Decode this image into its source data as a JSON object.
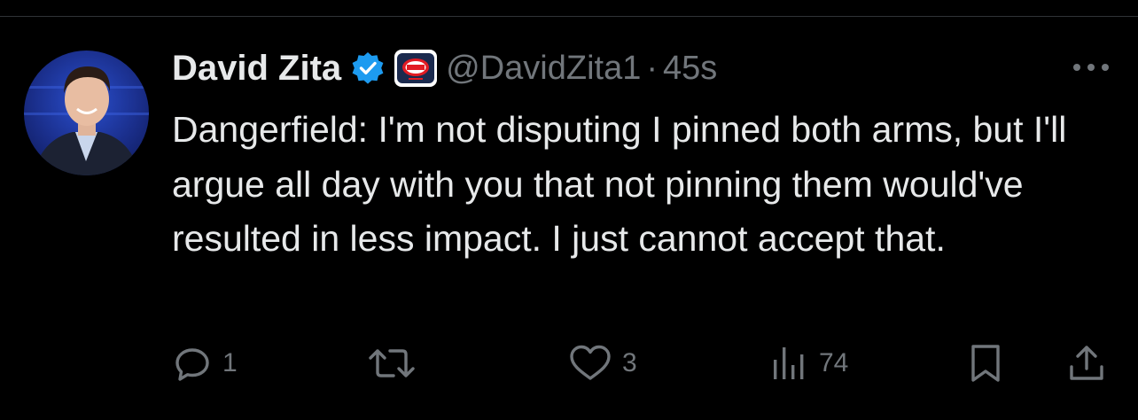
{
  "tweet": {
    "author": {
      "display_name": "David Zita",
      "handle": "@DavidZita1",
      "verified": true,
      "affiliation_badge": "fox-footy-logo"
    },
    "separator": "·",
    "timestamp": "45s",
    "text": "Dangerfield: I'm not disputing I pinned both arms, but I'll argue all day with you that not pinning them would've resulted in less impact. I just cannot accept that.",
    "actions": {
      "replies": "1",
      "reposts": "",
      "likes": "3",
      "views": "74"
    }
  },
  "colors": {
    "background": "#000000",
    "text_primary": "#e7e9ea",
    "text_secondary": "#71767b",
    "verified_blue": "#1d9bf0",
    "divider": "#2f3336"
  },
  "icons": {
    "more": "more-horizontal-icon",
    "reply": "reply-icon",
    "repost": "repost-icon",
    "like": "heart-icon",
    "views": "views-bar-chart-icon",
    "bookmark": "bookmark-icon",
    "share": "share-icon"
  }
}
